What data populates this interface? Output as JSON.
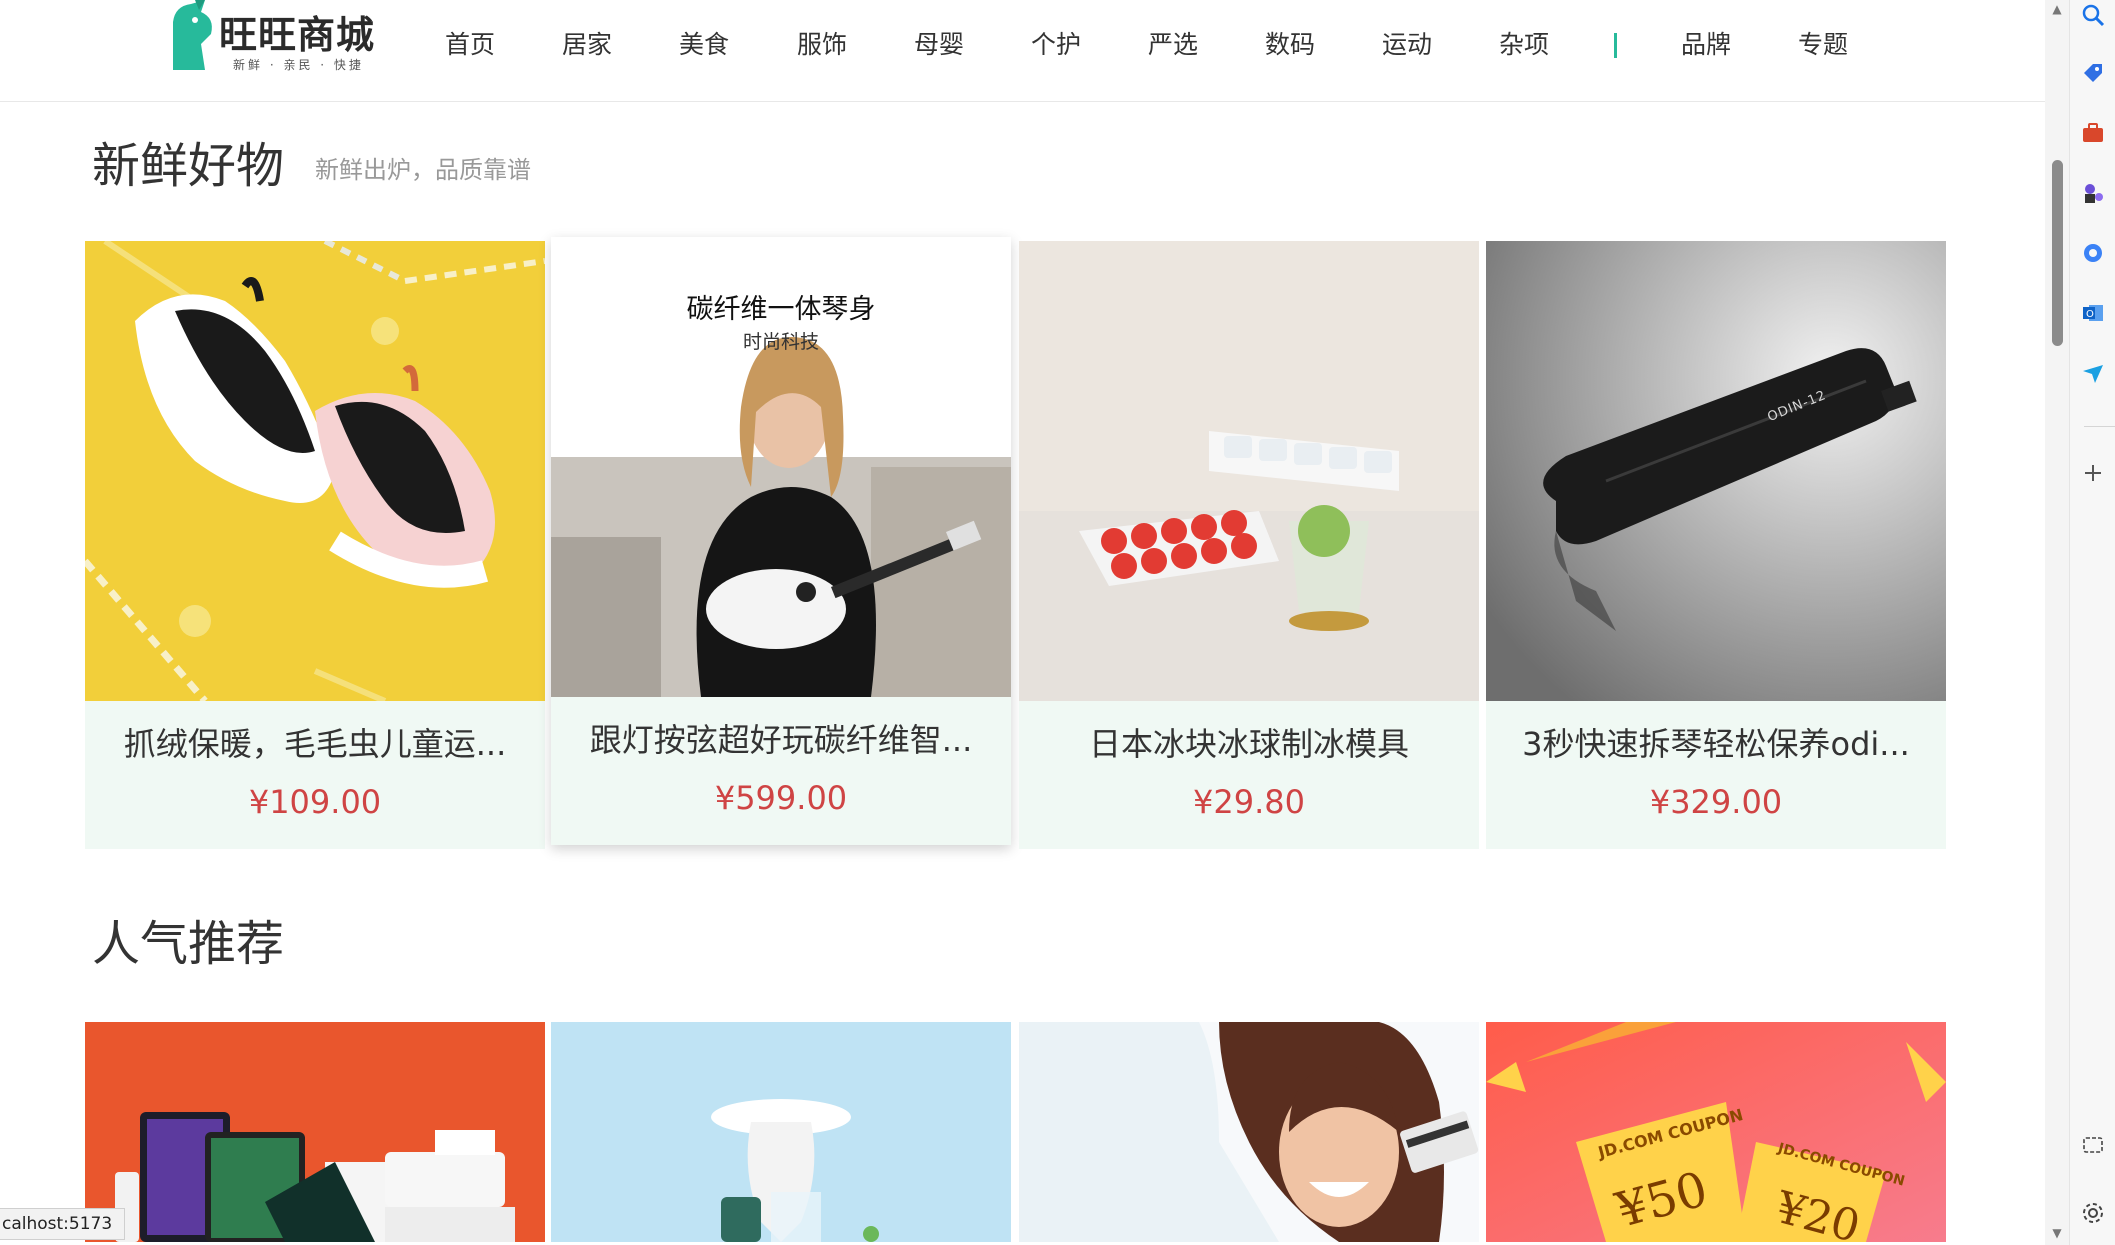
{
  "header": {
    "logo_title": "旺旺商城",
    "logo_sub": "新鲜 · 亲民 · 快捷",
    "nav": [
      "首页",
      "居家",
      "美食",
      "服饰",
      "母婴",
      "个护",
      "严选",
      "数码",
      "运动",
      "杂项"
    ],
    "nav_extra": [
      "品牌",
      "专题"
    ]
  },
  "fresh": {
    "title": "新鲜好物",
    "subtitle": "新鲜出炉，品质靠谱",
    "items": [
      {
        "name": "抓绒保暖，毛毛虫儿童运...",
        "price": "¥109.00"
      },
      {
        "name": "跟灯按弦超好玩碳纤维智...",
        "price": "¥599.00",
        "poster_title": "碳纤维一体琴身",
        "poster_sub": "时尚科技"
      },
      {
        "name": "日本冰块冰球制冰模具",
        "price": "¥29.80"
      },
      {
        "name": "3秒快速拆琴轻松保养odi...",
        "price": "¥329.00",
        "engraving": "ODIN-12"
      }
    ]
  },
  "popular": {
    "title": "人气推荐",
    "coupon_label": "JD.COM COUPON",
    "coupon_values": [
      "¥50",
      "¥20"
    ]
  },
  "statusbar": {
    "url": "calhost:5173"
  },
  "colors": {
    "brand": "#27ba9b",
    "price": "#cf4444",
    "card_bg": "#f0f9f4"
  }
}
